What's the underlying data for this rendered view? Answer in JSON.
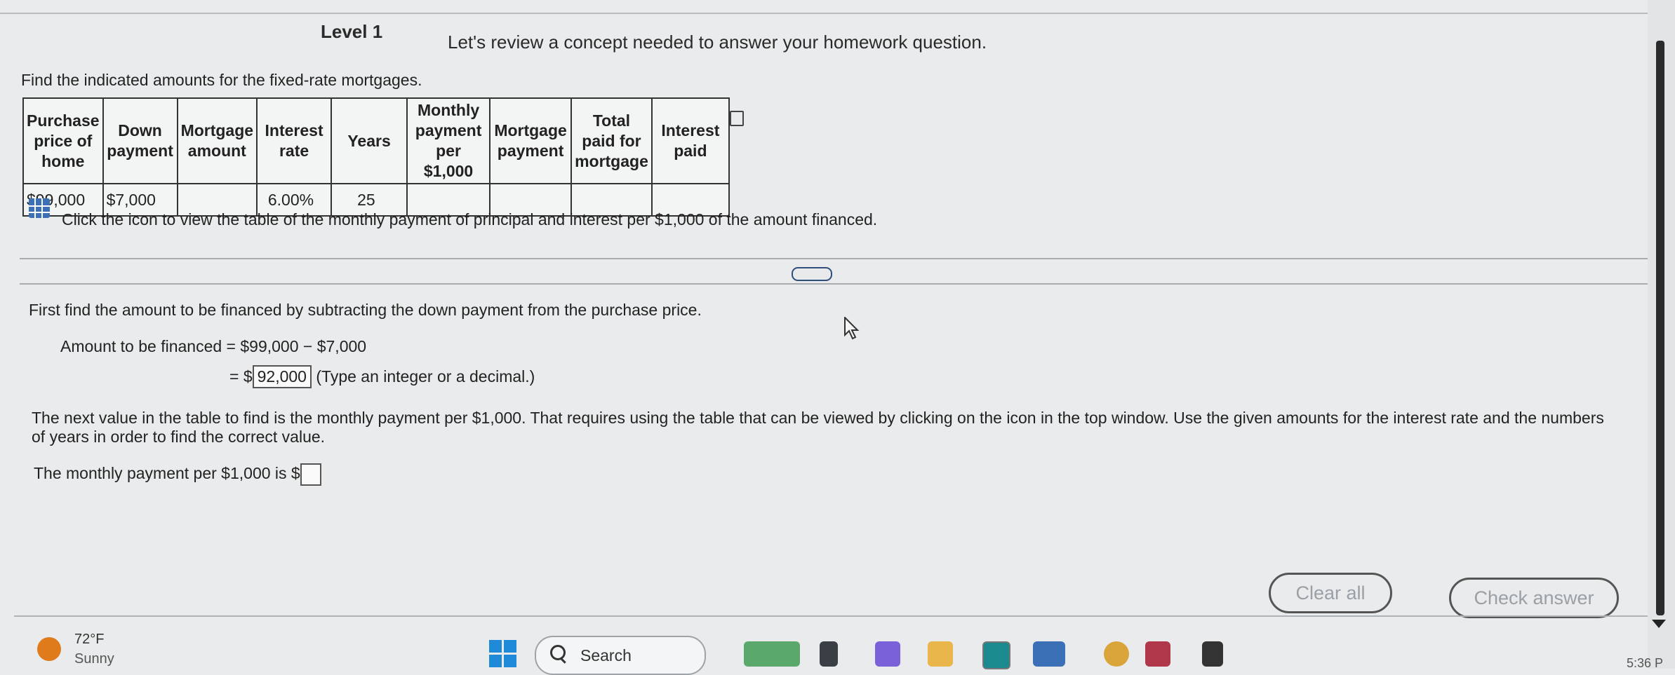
{
  "header": {
    "level": "Level 1",
    "message": "Let's review a concept needed to answer your homework question."
  },
  "problem": {
    "instruction": "Find the indicated amounts for the fixed-rate mortgages.",
    "table": {
      "headers": [
        [
          "Purchase",
          "price of",
          "home"
        ],
        [
          "Down",
          "payment"
        ],
        [
          "Mortgage",
          "amount"
        ],
        [
          "Interest",
          "rate"
        ],
        [
          "Years"
        ],
        [
          "Monthly",
          "payment",
          "per $1,000"
        ],
        [
          "Mortgage",
          "payment"
        ],
        [
          "Total",
          "paid for",
          "mortgage"
        ],
        [
          "Interest",
          "paid"
        ]
      ],
      "row": {
        "purchase_price": "$99,000",
        "down_payment": "$7,000",
        "mortgage_amount": "",
        "interest_rate": "6.00%",
        "years": "25",
        "monthly_per_1000": "",
        "mortgage_payment": "",
        "total_paid": "",
        "interest_paid": ""
      }
    },
    "icon_caption": "Click the icon to view the table of the monthly payment of principal and interest per $1,000 of the amount financed."
  },
  "solution": {
    "step1_text": "First find the amount to be financed by subtracting the down payment from the purchase price.",
    "amount_label": "Amount to be financed = $99,000 − $7,000",
    "equals_prefix": "= $",
    "amount_value": "92,000",
    "amount_hint": "(Type an integer or a decimal.)",
    "next_text_line1": "The next value in the table to find is the monthly payment per $1,000. That requires using the table that can be viewed by clicking on the icon in the top window. Use the given amounts for the interest rate and the numbers",
    "next_text_line2": "of years in order to find the correct value.",
    "monthly_label": "The monthly payment per $1,000 is $",
    "monthly_value": ""
  },
  "buttons": {
    "clear_all": "Clear all",
    "check_answer": "Check answer"
  },
  "taskbar": {
    "temperature": "72°F",
    "weather": "Sunny",
    "search_label": "Search",
    "clock": "5:36 P"
  },
  "colors": {
    "background": "#e9ebec",
    "icon_blue": "#3b6fb6",
    "weather_orange": "#e07b1c"
  }
}
